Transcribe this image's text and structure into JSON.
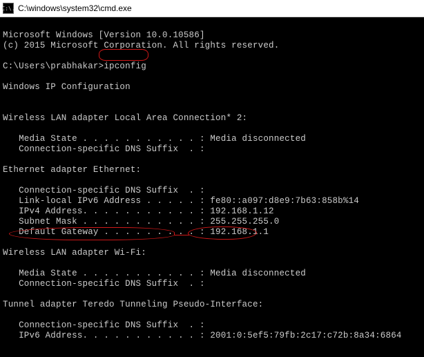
{
  "titlebar": {
    "icon_text": "C:\\.",
    "title": "C:\\windows\\system32\\cmd.exe"
  },
  "lines": {
    "l1": "Microsoft Windows [Version 10.0.10586]",
    "l2": "(c) 2015 Microsoft Corporation. All rights reserved.",
    "l3": "",
    "l4_prompt": "C:\\Users\\prabhakar>",
    "l4_cmd": "ipconfig",
    "l5": "",
    "l6": "Windows IP Configuration",
    "l7": "",
    "l8": "",
    "l9": "Wireless LAN adapter Local Area Connection* 2:",
    "l10": "",
    "l11": "   Media State . . . . . . . . . . . : Media disconnected",
    "l12": "   Connection-specific DNS Suffix  . :",
    "l13": "",
    "l14": "Ethernet adapter Ethernet:",
    "l15": "",
    "l16": "   Connection-specific DNS Suffix  . :",
    "l17": "   Link-local IPv6 Address . . . . . : fe80::a097:d8e9:7b63:858b%14",
    "l18": "   IPv4 Address. . . . . . . . . . . : 192.168.1.12",
    "l19": "   Subnet Mask . . . . . . . . . . . : 255.255.255.0",
    "l20": "   Default Gateway . . . . . . . . . : 192.168.1.1",
    "l21": "",
    "l22": "Wireless LAN adapter Wi-Fi:",
    "l23": "",
    "l24": "   Media State . . . . . . . . . . . : Media disconnected",
    "l25": "   Connection-specific DNS Suffix  . :",
    "l26": "",
    "l27": "Tunnel adapter Teredo Tunneling Pseudo-Interface:",
    "l28": "",
    "l29": "   Connection-specific DNS Suffix  . :",
    "l30": "   IPv6 Address. . . . . . . . . . . : 2001:0:5ef5:79fb:2c17:c72b:8a34:6864"
  }
}
